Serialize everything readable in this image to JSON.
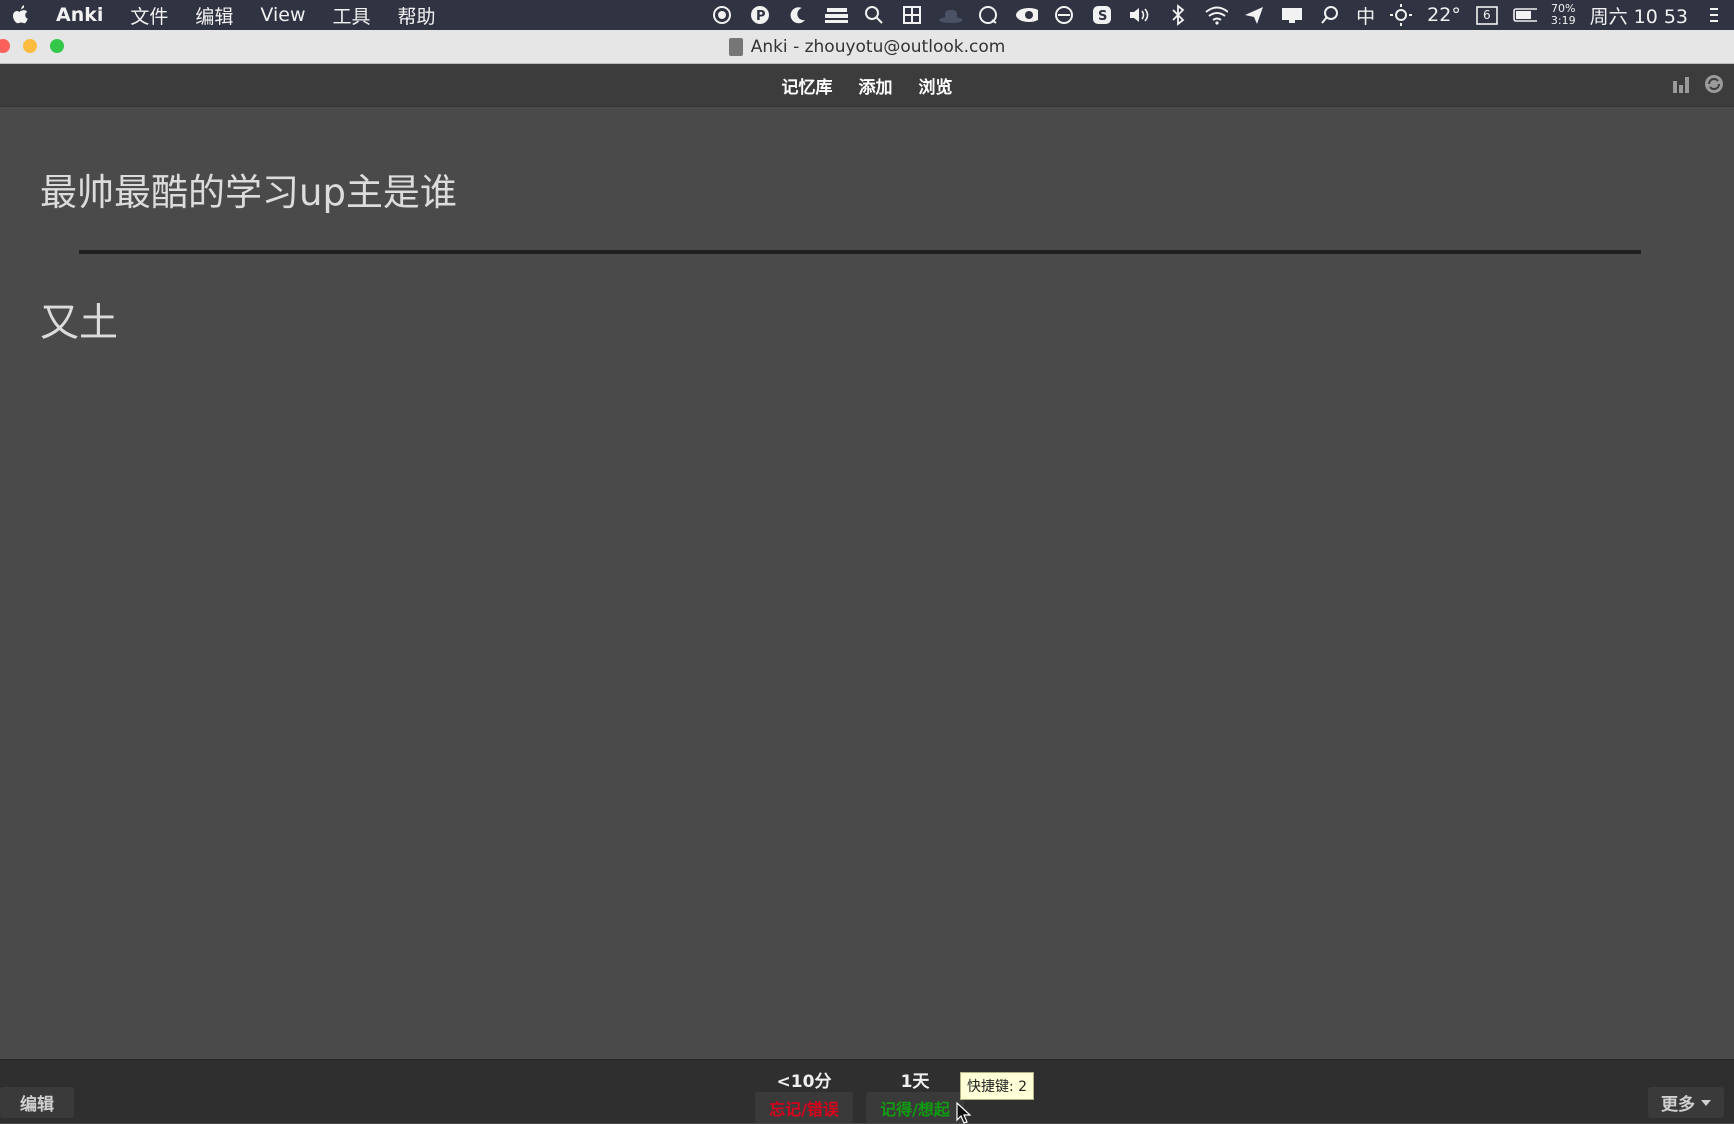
{
  "menubar": {
    "app": "Anki",
    "items": [
      "文件",
      "编辑",
      "View",
      "工具",
      "帮助"
    ],
    "temperature": "22°",
    "ime": "中",
    "battery_percent": "70%",
    "battery_time": "3:19",
    "calendar_day": "6",
    "datetime": "周六 10 53"
  },
  "window": {
    "title": "Anki - zhouyotu@outlook.com"
  },
  "toolbar": {
    "decks": "记忆库",
    "add": "添加",
    "browse": "浏览"
  },
  "card": {
    "question": "最帅最酷的学习up主是谁",
    "answer": "又土"
  },
  "bottom": {
    "edit": "编辑",
    "again_time": "<10分",
    "again_label": "忘记/错误",
    "good_time": "1天",
    "good_label": "记得/想起",
    "tooltip": "快捷键: 2",
    "more": "更多"
  },
  "colors": {
    "again": "#d8001c",
    "good": "#109b10",
    "card_bg": "#4a4a4a"
  }
}
